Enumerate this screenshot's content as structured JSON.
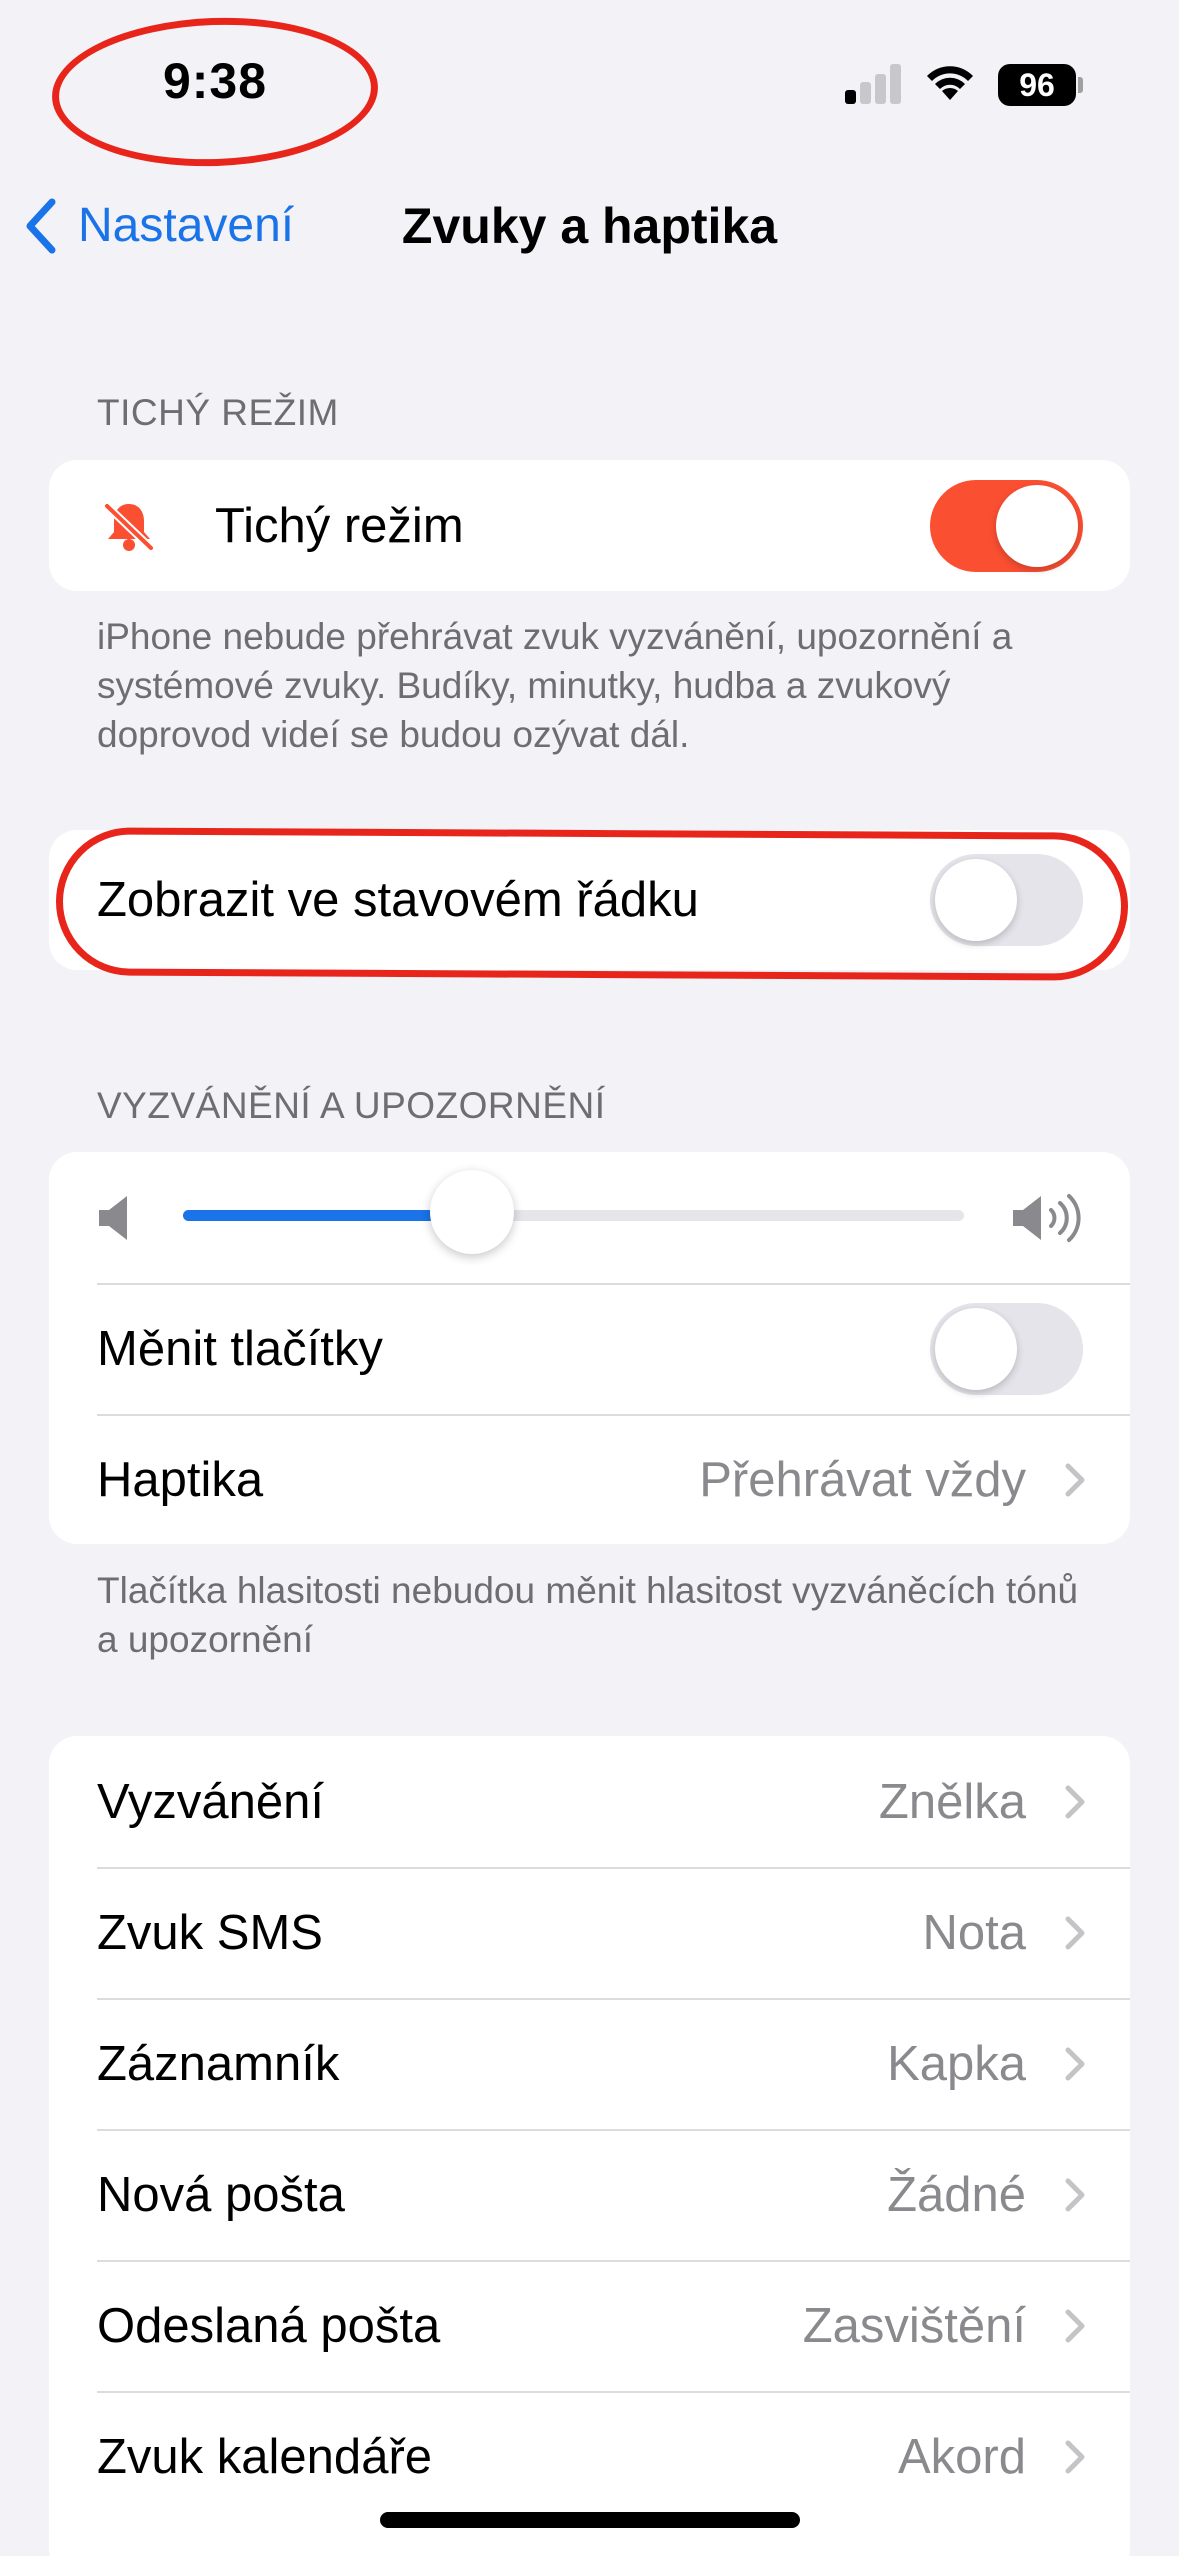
{
  "status_bar": {
    "time": "9:38",
    "battery": "96",
    "signal_bars_active": 1
  },
  "nav": {
    "back_label": "Nastavení",
    "title": "Zvuky a haptika"
  },
  "silent_section": {
    "header": "TICHÝ REŽIM",
    "row_label": "Tichý režim",
    "toggle_on": true,
    "footer": "iPhone nebude přehrávat zvuk vyzvánění, upozornění a systémové zvuky. Budíky, minutky, hudba a zvukový doprovod videí se budou ozývat dál."
  },
  "status_bar_section": {
    "row_label": "Zobrazit ve stavovém řádku",
    "toggle_on": false
  },
  "ringer_section": {
    "header": "VYZVÁNĚNÍ A UPOZORNĚNÍ",
    "volume_level": 0.37,
    "change_with_buttons_label": "Měnit tlačítky",
    "change_with_buttons_on": false,
    "haptics_label": "Haptika",
    "haptics_value": "Přehrávat vždy",
    "footer": "Tlačítka hlasitosti nebudou měnit hlasitost vyzváněcích tónů a upozornění"
  },
  "sounds_list": [
    {
      "label": "Vyzvánění",
      "value": "Znělka"
    },
    {
      "label": "Zvuk SMS",
      "value": "Nota"
    },
    {
      "label": "Záznamník",
      "value": "Kapka"
    },
    {
      "label": "Nová pošta",
      "value": "Žádné"
    },
    {
      "label": "Odeslaná pošta",
      "value": "Zasvištění"
    },
    {
      "label": "Zvuk kalendáře",
      "value": "Akord"
    }
  ],
  "colors": {
    "accent": "#1a73e8",
    "toggle_on": "#fb4f32",
    "annotation": "#e8251b"
  }
}
